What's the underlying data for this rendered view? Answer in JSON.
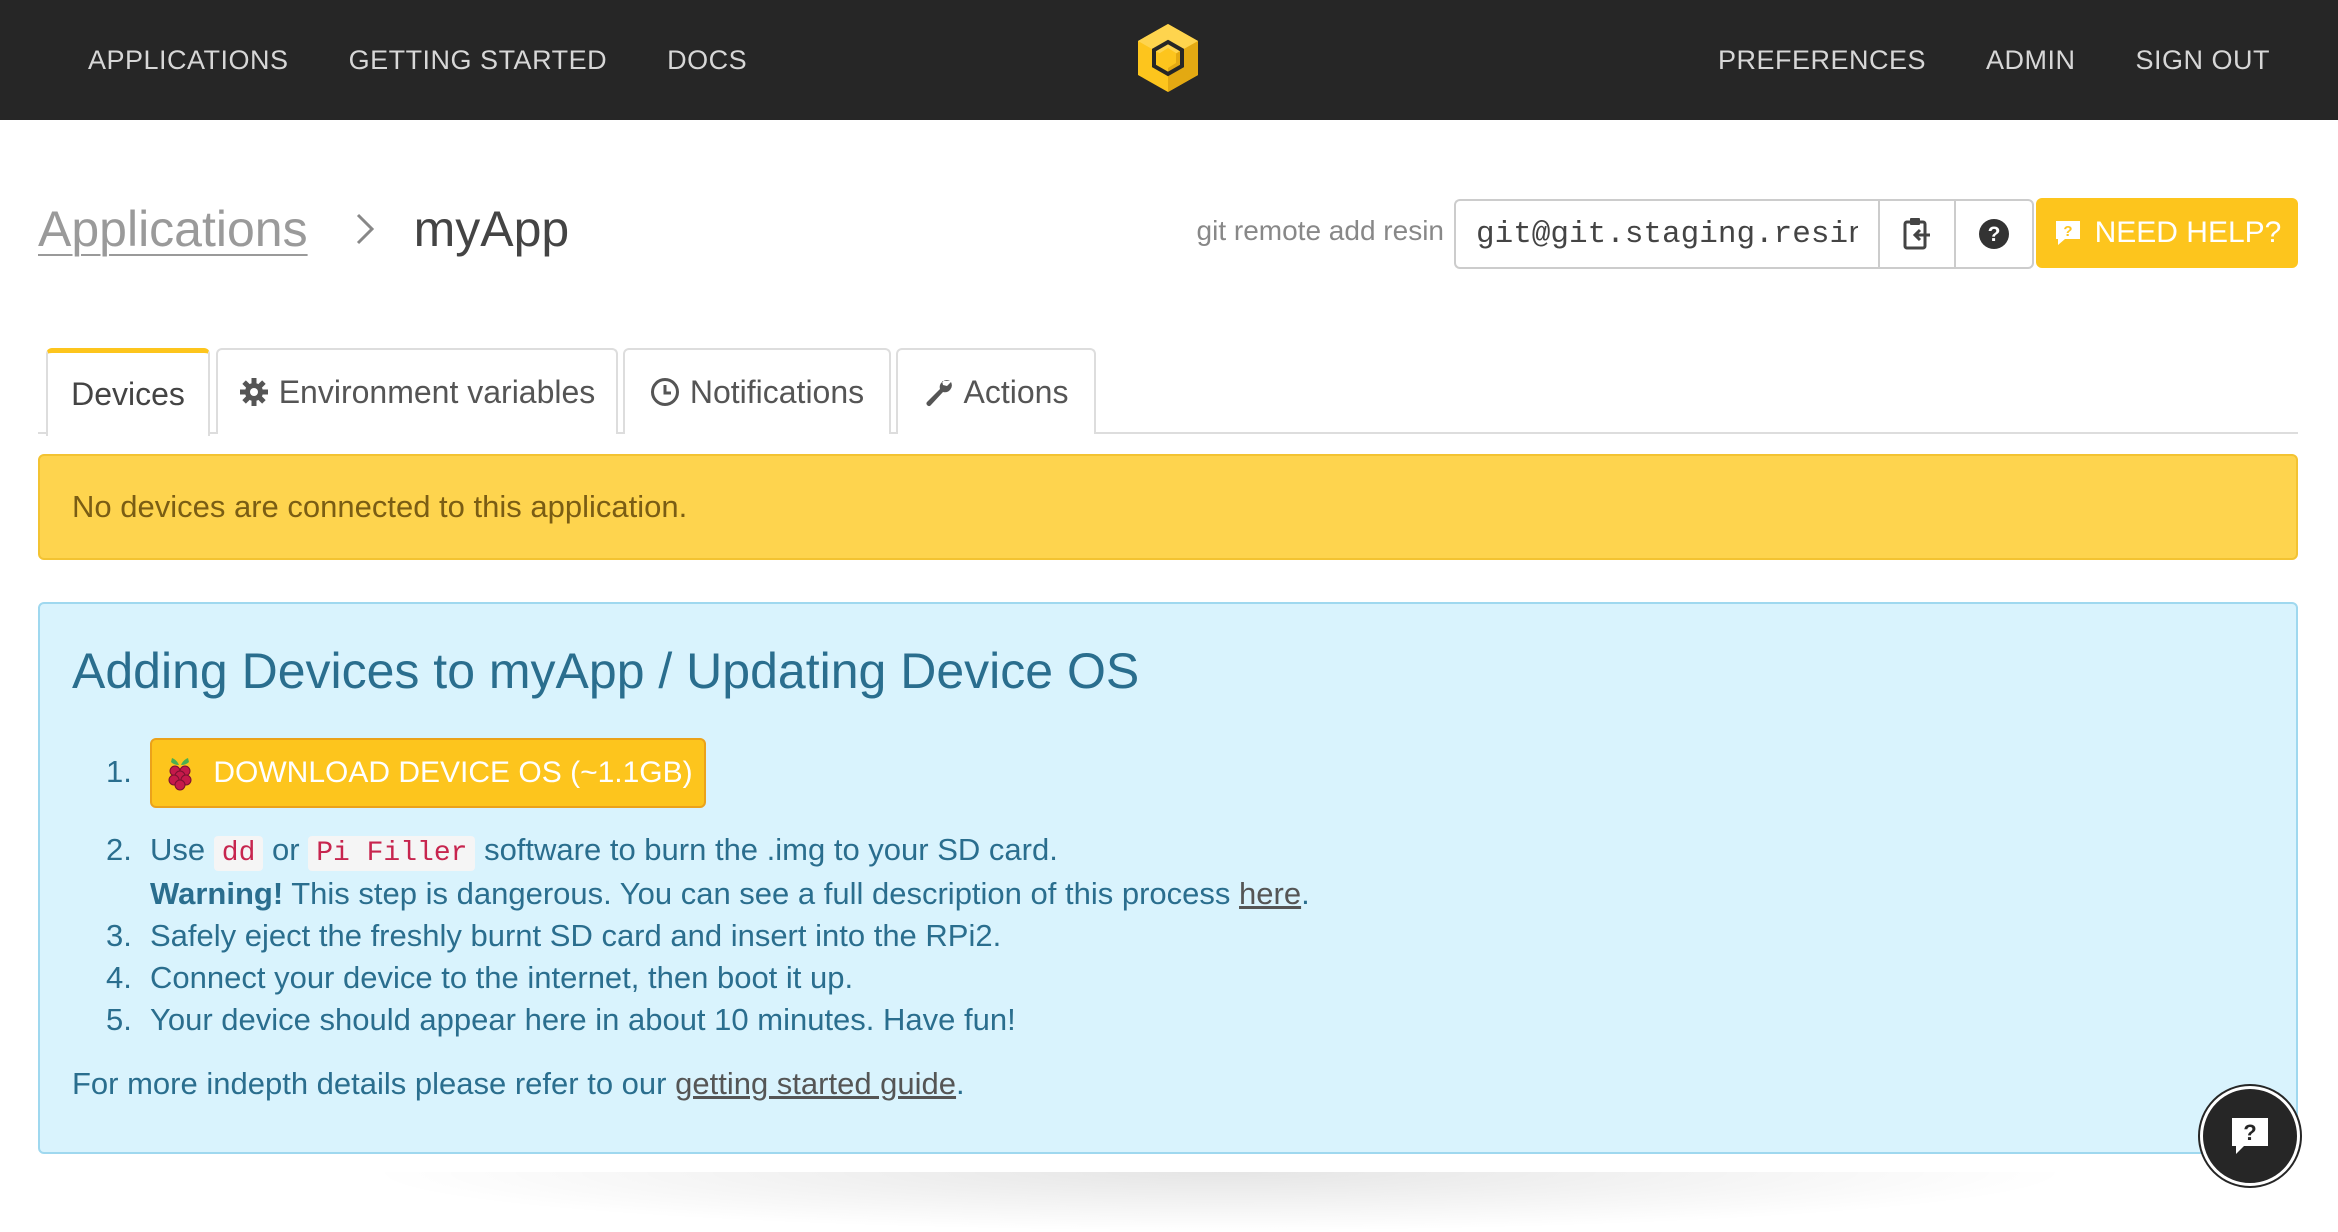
{
  "topnav": {
    "left_links": [
      "APPLICATIONS",
      "GETTING STARTED",
      "DOCS"
    ],
    "right_links": [
      "PREFERENCES",
      "ADMIN",
      "SIGN OUT"
    ],
    "logo": "cube-logo-icon",
    "background": "#262626"
  },
  "breadcrumb": {
    "parent": "Applications",
    "current": "myApp"
  },
  "git": {
    "label": "git remote add resin",
    "value": "git@git.staging.resin"
  },
  "help_button": {
    "label": "NEED HELP?"
  },
  "tabs": [
    {
      "label": "Devices",
      "icon": "",
      "active": true
    },
    {
      "label": "Environment variables",
      "icon": "gear-icon",
      "active": false
    },
    {
      "label": "Notifications",
      "icon": "clock-icon",
      "active": false
    },
    {
      "label": "Actions",
      "icon": "wrench-icon",
      "active": false
    }
  ],
  "alert": {
    "text": "No devices are connected to this application.",
    "color": "#fed44e"
  },
  "info": {
    "title": "Adding Devices to myApp / Updating Device OS",
    "download_label": "DOWNLOAD DEVICE OS (~1.1GB)",
    "step2": {
      "use": "Use",
      "code1": "dd",
      "or": "or",
      "code2": "Pi Filler",
      "rest": "software to burn the .img to your SD card.",
      "warning_bold": "Warning!",
      "warning_text": "This step is dangerous. You can see a full description of this process",
      "warning_link": "here",
      "period": "."
    },
    "step3": "Safely eject the freshly burnt SD card and insert into the RPi2.",
    "step4": "Connect your device to the internet, then boot it up.",
    "step5": "Your device should appear here in about 10 minutes. Have fun!",
    "footer_text": "For more indepth details please refer to our",
    "footer_link": "getting started guide",
    "footer_period": ".",
    "numbers": [
      "1.",
      "2.",
      "3.",
      "4.",
      "5."
    ],
    "color": "#d9f3fd"
  },
  "chat": {
    "label": "?"
  }
}
